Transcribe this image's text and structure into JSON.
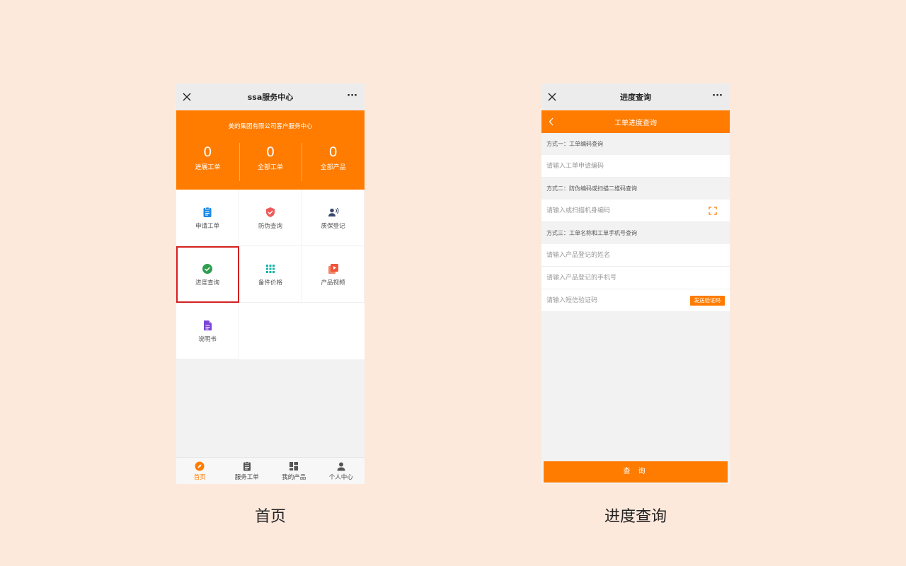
{
  "home": {
    "window_title": "ssa服务中心",
    "banner_subtitle": "美的集团有限公司客户服务中心",
    "stats": [
      {
        "value": "0",
        "label": "进展工单"
      },
      {
        "value": "0",
        "label": "全部工单"
      },
      {
        "value": "0",
        "label": "全部产品"
      }
    ],
    "grid": [
      {
        "label": "申请工单",
        "icon": "clipboard-icon",
        "color": "#1e88e5"
      },
      {
        "label": "防伪查询",
        "icon": "shield-check-icon",
        "color": "#f05a5a"
      },
      {
        "label": "质保登记",
        "icon": "user-voice-icon",
        "color": "#3b4a6b"
      },
      {
        "label": "进度查询",
        "icon": "check-circle-icon",
        "color": "#2e9e4f"
      },
      {
        "label": "备件价格",
        "icon": "grid-dots-icon",
        "color": "#16b3a6"
      },
      {
        "label": "产品视频",
        "icon": "video-icon",
        "color": "#f0553a"
      },
      {
        "label": "说明书",
        "icon": "document-icon",
        "color": "#7a45d6"
      }
    ],
    "tabs": [
      {
        "label": "首页",
        "icon": "compass-icon"
      },
      {
        "label": "服务工单",
        "icon": "clipboard-icon"
      },
      {
        "label": "我的产品",
        "icon": "dashboard-icon"
      },
      {
        "label": "个人中心",
        "icon": "person-icon"
      }
    ],
    "caption": "首页"
  },
  "query": {
    "window_title": "进度查询",
    "nav_title": "工单进度查询",
    "method1_title": "方式一：工单编码查询",
    "method1_placeholder": "请输入工单申请编码",
    "method2_title": "方式二：防伪编码或扫描二维码查询",
    "method2_placeholder": "请输入或扫描机身编码",
    "method3_title": "方式三：工单名称和工单手机号查询",
    "name_placeholder": "请输入产品登记的姓名",
    "phone_placeholder": "请输入产品登记的手机号",
    "sms_placeholder": "请输入短信验证码",
    "sms_button": "发送验证码",
    "submit_button": "查 询",
    "caption": "进度查询"
  },
  "colors": {
    "accent": "#ff7c00",
    "selection": "#d42020",
    "background": "#fde9dc"
  }
}
